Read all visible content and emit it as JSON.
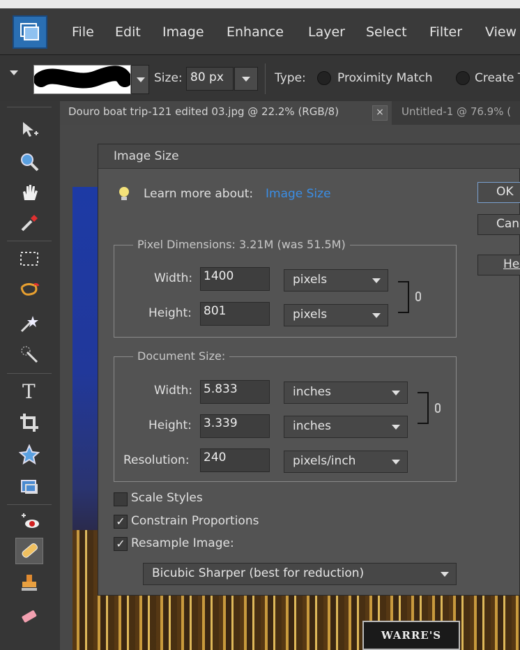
{
  "menubar": {
    "items": [
      "File",
      "Edit",
      "Image",
      "Enhance",
      "Layer",
      "Select",
      "Filter",
      "View"
    ]
  },
  "options_bar": {
    "size_label": "Size:",
    "size_value": "80 px",
    "type_label": "Type:",
    "type_options": [
      "Proximity Match",
      "Create T"
    ]
  },
  "tabs": [
    {
      "label": "Douro boat trip-121 edited 03.jpg @ 22.2% (RGB/8)",
      "close": "×"
    },
    {
      "label": "Untitled-1 @ 76.9% ("
    }
  ],
  "toolbox": {
    "tools": [
      "move-tool",
      "zoom-tool",
      "hand-tool",
      "eyedropper-tool",
      "rectangular-marquee-tool",
      "lasso-tool",
      "magic-wand-tool",
      "quick-selection-tool",
      "type-tool",
      "crop-tool",
      "custom-shape-tool",
      "rectangle-shape-tool",
      "red-eye-tool",
      "spot-healing-brush-tool",
      "clone-stamp-tool",
      "eraser-tool"
    ]
  },
  "image": {
    "sign_text": "WARRE'S"
  },
  "dialog": {
    "title": "Image Size",
    "learn_more_prefix": "Learn more about:",
    "learn_more_link": "Image Size",
    "buttons": {
      "ok": "OK",
      "cancel": "Cancel",
      "help": "Help"
    },
    "pixel_dimensions": {
      "legend": "Pixel Dimensions:  3.21M (was 51.5M)",
      "width_label": "Width:",
      "width_value": "1400",
      "width_unit": "pixels",
      "height_label": "Height:",
      "height_value": "801",
      "height_unit": "pixels"
    },
    "document_size": {
      "legend": "Document Size:",
      "width_label": "Width:",
      "width_value": "5.833",
      "width_unit": "inches",
      "height_label": "Height:",
      "height_value": "3.339",
      "height_unit": "inches",
      "resolution_label": "Resolution:",
      "resolution_value": "240",
      "resolution_unit": "pixels/inch"
    },
    "scale_styles": {
      "label": "Scale Styles",
      "checked": false
    },
    "constrain_proportions": {
      "label": "Constrain Proportions",
      "checked": true
    },
    "resample_image": {
      "label": "Resample Image:",
      "checked": true
    },
    "resample_method": "Bicubic Sharper (best for reduction)",
    "colors": {
      "link": "#3a8ee6",
      "dialog_bg": "#535353"
    }
  }
}
